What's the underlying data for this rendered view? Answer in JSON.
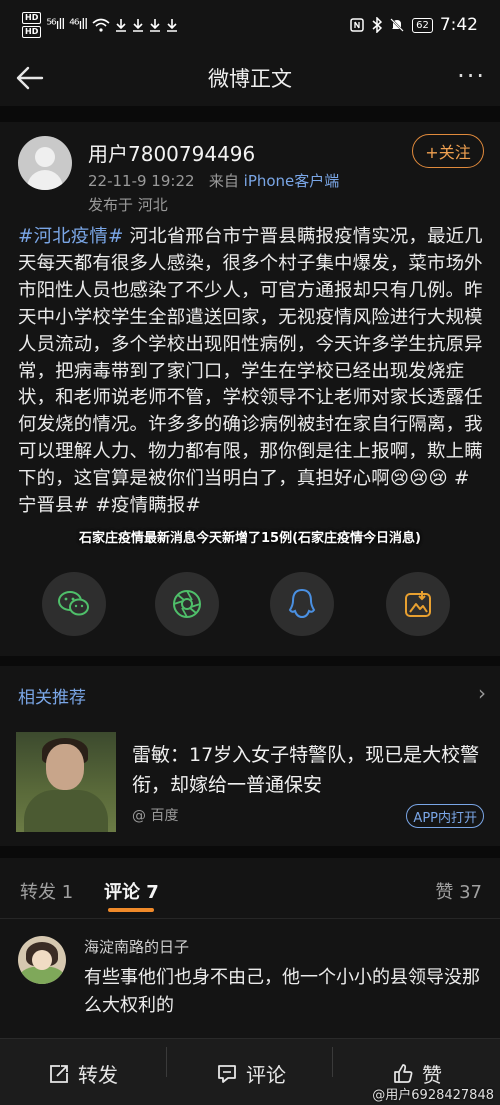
{
  "status_bar": {
    "hd1": "HD",
    "hd2": "HD",
    "signal1": "⁵⁶ıll",
    "signal2": "⁴⁶ıll",
    "battery": "62",
    "time": "7:42"
  },
  "nav": {
    "title": "微博正文",
    "more": "···"
  },
  "post": {
    "username": "用户7800794496",
    "datetime": "22-11-9 19:22",
    "from_label": "来自",
    "source": "iPhone客户端",
    "location": "发布于 河北",
    "follow_label": "+关注",
    "hashtag": "#河北疫情#",
    "text": " 河北省邢台市宁晋县瞒报疫情实况，最近几天每天都有很多人感染，很多个村子集中爆发，菜市场外市阳性人员也感染了不少人，可官方通报却只有几例。昨天中小学校学生全部遣送回家，无视疫情风险进行大规模人员流动，多个学校出现阳性病例，今天许多学生抗原异常，把病毒带到了家门口，学生在学校已经出现发烧症状，和老师说老师不管，学校领导不让老师对家长透露任何发烧的情况。许多多的确诊病例被封在家自行隔离，我可以理解人力、物力都有限，那你倒是往上报啊，欺上瞒下的，这官算是被你们当明白了，真担好心啊😢😢😢 #宁晋县# #疫情瞒报#",
    "overlay_caption": "石家庄疫情最新消息今天新增了15例(石家庄疫情今日消息)"
  },
  "share": {
    "icons": [
      "wechat-icon",
      "moments-icon",
      "qq-icon",
      "gallery-icon"
    ]
  },
  "related": {
    "title": "相关推荐",
    "headline": "雷敏：17岁入女子特警队，现已是大校警衔，却嫁给一普通保安",
    "source": "@ 百度",
    "open_app": "APP内打开"
  },
  "tabs": {
    "repost": "转发 1",
    "comment": "评论 7",
    "like": "赞 37"
  },
  "comment": {
    "name": "海淀南路的日子",
    "text": "有些事他们也身不由己，他一个小小的县领导没那么大权利的"
  },
  "bottom": {
    "repost": "转发",
    "comment": "评论",
    "like": "赞",
    "watermark": "@用户6928427848"
  },
  "colors": {
    "accent_orange": "#f08a2a",
    "link_blue": "#7aa6e6",
    "background": "#141414"
  }
}
